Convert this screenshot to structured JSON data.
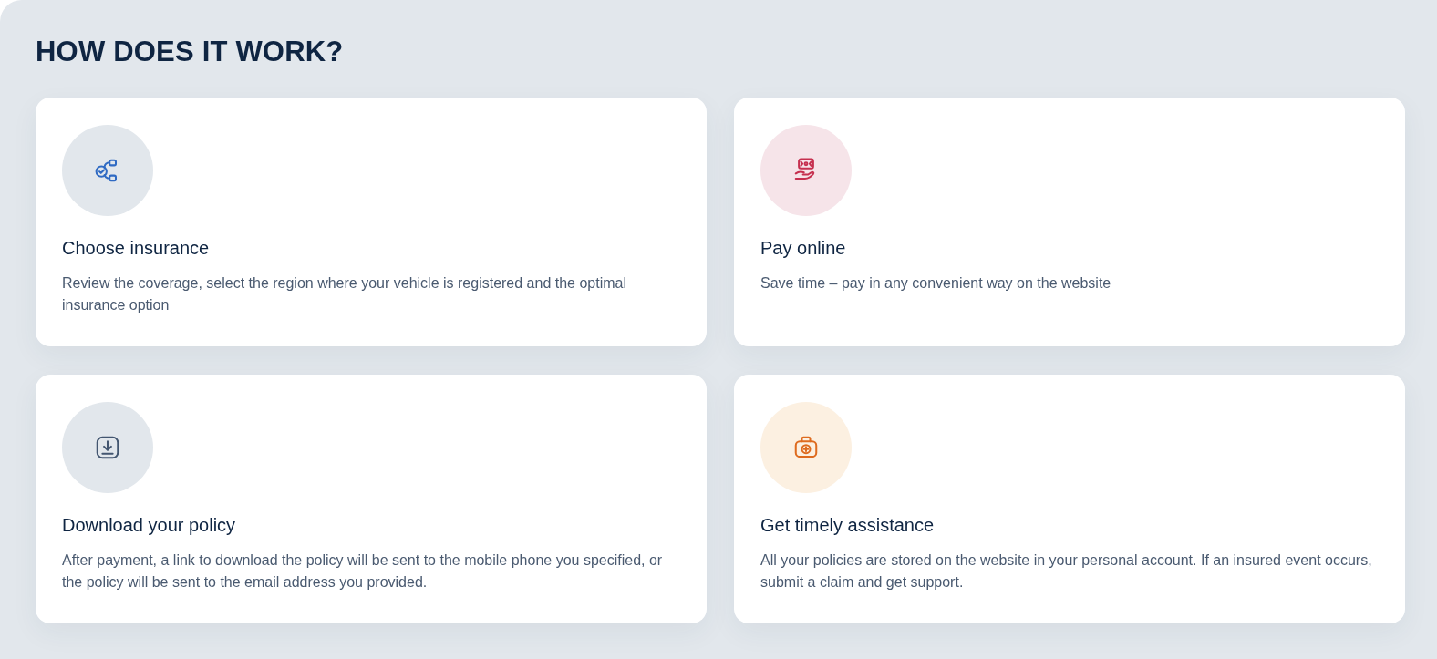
{
  "heading": "HOW DOES IT WORK?",
  "steps": [
    {
      "kind": "choose",
      "title": "Choose insurance",
      "text": "Review the coverage, select the region where your vehicle is registered and the optimal insurance option"
    },
    {
      "kind": "pay",
      "title": "Pay online",
      "text": "Save time – pay in any convenient way on the website"
    },
    {
      "kind": "download",
      "title": "Download your policy",
      "text": "After payment, a link to download the policy will be sent to the mobile phone you specified, or the policy will be sent to the email address you provided."
    },
    {
      "kind": "assist",
      "title": "Get timely assistance",
      "text": "All your policies are stored on the website in your personal account. If an insured event occurs, submit a claim and get support."
    }
  ]
}
